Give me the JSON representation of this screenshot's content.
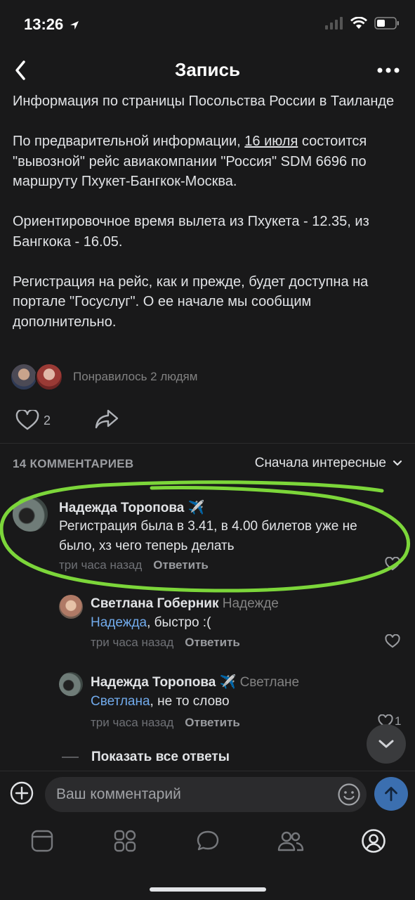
{
  "status_bar": {
    "time": "13:26"
  },
  "nav": {
    "title": "Запись"
  },
  "post": {
    "paragraphs": [
      "Информация по страницы Посольства России в Таиланде",
      "По предварительной информации, ",
      "Ориентировочное время вылета из Пхукета - 12.35, из Бангкока - 16.05.",
      "Регистрация на рейс, как и прежде, будет доступна на портале \"Госуслуг\". О ее начале мы сообщим дополнительно."
    ],
    "p2_link": "16 июля",
    "p2_rest": " состоится \"вывозной\" рейс авиакомпании \"Россия\" SDM 6696 по маршруту Пхукет-Бангкок-Москва.",
    "likes_text": "Понравилось 2 людям",
    "like_count": "2"
  },
  "comments_header": {
    "count_label": "14 КОММЕНТАРИЕВ",
    "sort_label": "Сначала интересные"
  },
  "comments": [
    {
      "author": "Надежда Торопова ✈️",
      "reply_to": "",
      "mention": "",
      "text": "Регистрация была в 3.41, в 4.00 билетов уже не было, хз чего теперь делать",
      "time": "три часа назад",
      "reply_label": "Ответить",
      "likes": ""
    },
    {
      "author": "Светлана Гоберник",
      "reply_to": "Надежде",
      "mention": "Надежда",
      "text": ", быстро :(",
      "time": "три часа назад",
      "reply_label": "Ответить",
      "likes": ""
    },
    {
      "author": "Надежда Торопова ✈️",
      "reply_to": "Светлане",
      "mention": "Светлана",
      "text": ", не то слово",
      "time": "три часа назад",
      "reply_label": "Ответить",
      "likes": "1"
    }
  ],
  "show_all_label": "Показать все ответы",
  "composer": {
    "placeholder": "Ваш комментарий"
  },
  "tabs": [
    "home-icon",
    "services-icon",
    "messages-icon",
    "friends-icon",
    "profile-icon"
  ],
  "colors": {
    "background": "#19191a",
    "link": "#71aaeb",
    "highlight": "#7cd63a",
    "send": "#3b6fb0"
  }
}
